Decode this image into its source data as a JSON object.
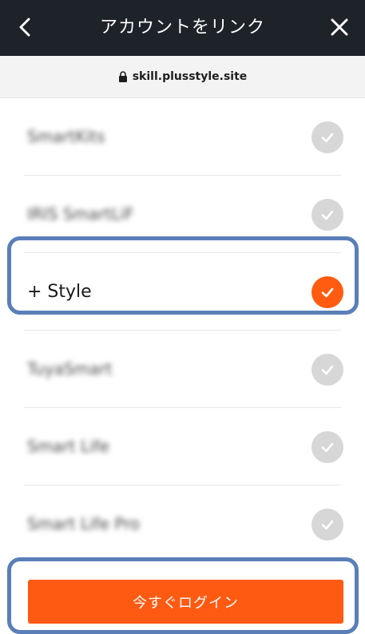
{
  "header": {
    "title": "アカウントをリンク",
    "back_icon": "chevron-left-icon",
    "close_icon": "close-icon"
  },
  "urlbar": {
    "url": "skill.plusstyle.site",
    "lock_icon": "lock-icon"
  },
  "accounts": [
    {
      "label": "SmartKits",
      "checked": false,
      "blurred": true
    },
    {
      "label": "IRIS SmartLiF",
      "checked": false,
      "blurred": true
    },
    {
      "label": "+ Style",
      "checked": true,
      "blurred": false
    },
    {
      "label": "TuyaSmart",
      "checked": false,
      "blurred": true
    },
    {
      "label": "Smart Life",
      "checked": false,
      "blurred": true
    },
    {
      "label": "Smart Life Pro",
      "checked": false,
      "blurred": true
    }
  ],
  "footer": {
    "login_label": "今すぐログイン"
  },
  "colors": {
    "header_bg": "#1e2229",
    "accent": "#ff5a11",
    "check_off": "#d7d7d7",
    "highlight": "#5a7fb8"
  }
}
